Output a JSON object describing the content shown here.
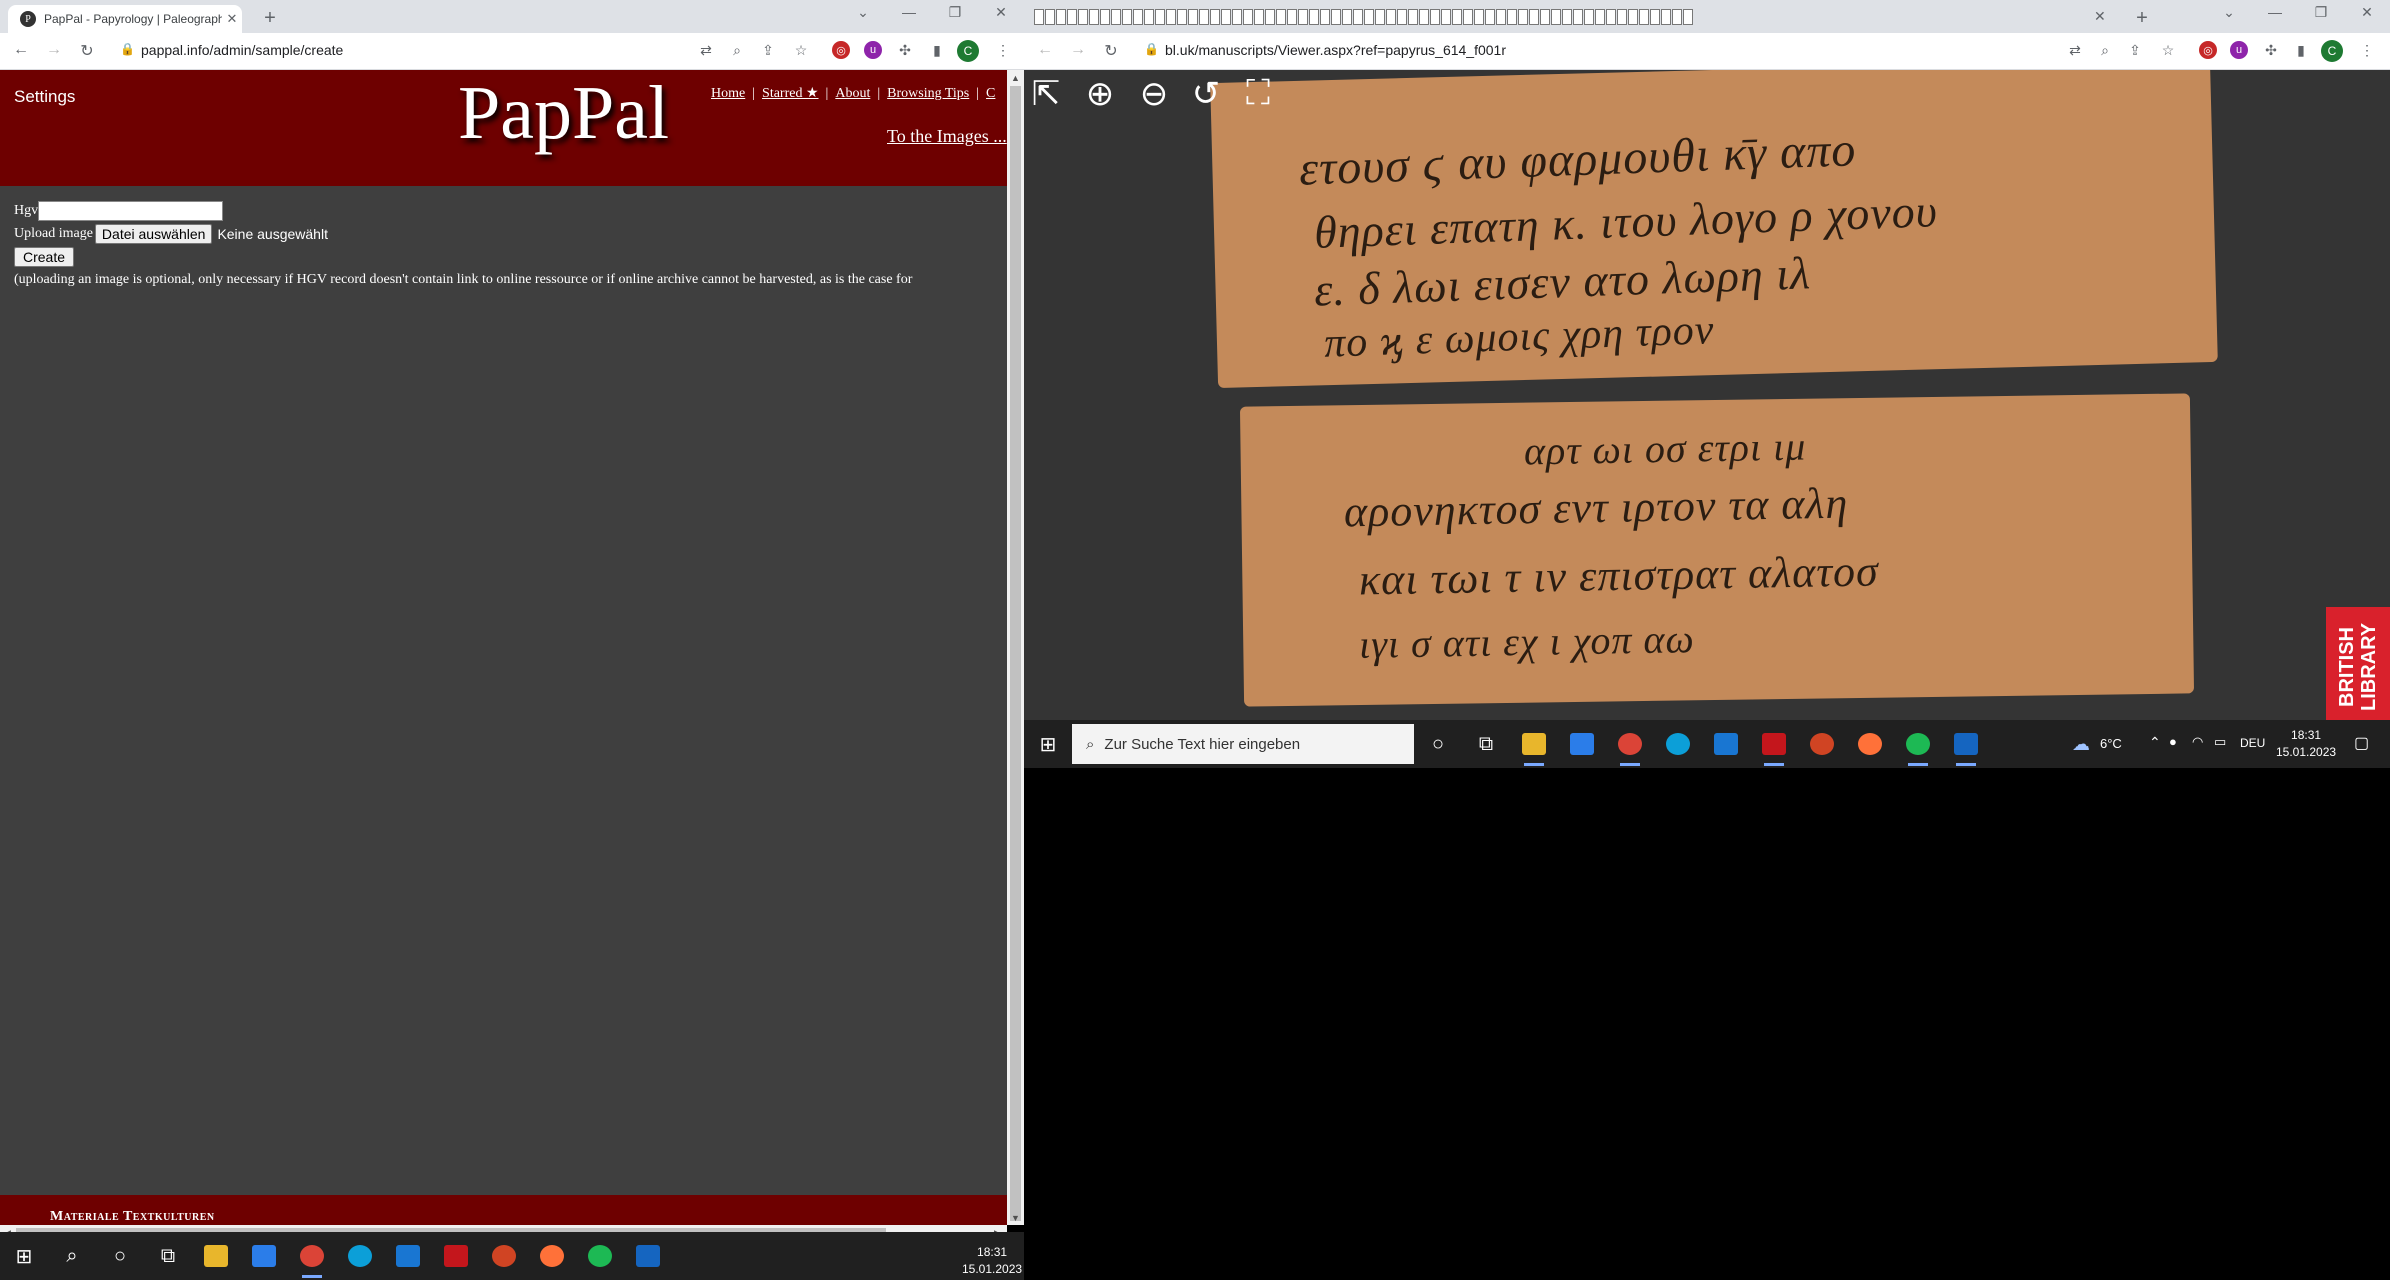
{
  "left_window": {
    "tab": {
      "title": "PapPal - Papyrology | Paleograph",
      "favicon": "P"
    },
    "new_tab": "+",
    "url": "pappal.info/admin/sample/create",
    "profile_initial": "C",
    "page": {
      "settings": "Settings",
      "brand": "PapPal",
      "nav": [
        {
          "label": "Home"
        },
        {
          "label": "Starred ★"
        },
        {
          "label": "About"
        },
        {
          "label": "Browsing Tips"
        },
        {
          "label": "C"
        }
      ],
      "to_images": "To the Images ...",
      "form": {
        "hgv_label": "Hgv",
        "hgv_value": "",
        "upload_label": "Upload image",
        "file_button": "Datei auswählen",
        "no_file": "Keine ausgewählt",
        "create_button": "Create",
        "note": "(uploading an image is optional, only necessary if HGV record doesn't contain link to online ressource or if online archive cannot be harvested, as is the case for"
      },
      "footer": "Materiale Textkulturen"
    },
    "taskbar": {
      "time": "18:31",
      "date": "15.01.2023"
    }
  },
  "right_window": {
    "url": "bl.uk/manuscripts/Viewer.aspx?ref=papyrus_614_f001r",
    "profile_initial": "C",
    "new_tab": "+",
    "viewer": {
      "logo": "BRITISH LIBRARY",
      "papyrus_lines": [
        "ετουσ ϛ αυ φαρμουθι κ̄γ απο",
        "θηρει επατη κ. ιτου λογο ρ χονου",
        "ε. δ λωι εισεν ατο λωρη ιλ",
        "πο ϗ ε ωμοις χρη τρον",
        "αρτ ωι οσ ετρι ιμ",
        "αρονηκτοσ εντ ιρτον τα αλη",
        "και τωι τ ιν επιστρατ αλατοσ",
        "ιγι σ ατι εχ ι χοπ αω"
      ]
    },
    "taskbar": {
      "search_placeholder": "Zur Suche Text hier eingeben",
      "weather": "6°C",
      "lang": "DEU",
      "time": "18:31",
      "date": "15.01.2023"
    }
  }
}
